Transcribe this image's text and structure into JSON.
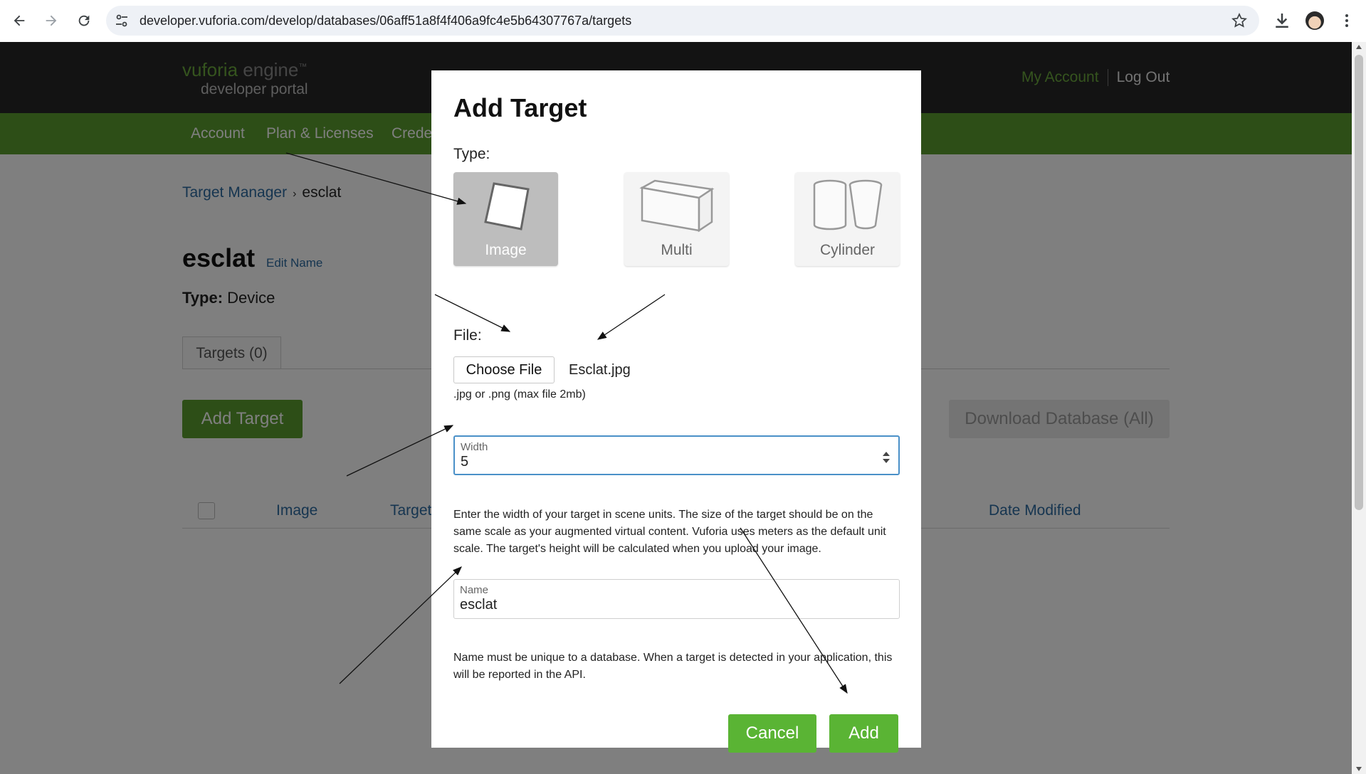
{
  "browser": {
    "url": "developer.vuforia.com/develop/databases/06aff51a8f4f406a9fc4e5b64307767a/targets"
  },
  "site": {
    "logo_brand": "vuforia",
    "logo_suffix": " engine",
    "logo_tm": "™",
    "logo_sub": "developer portal",
    "my_account": "My Account",
    "log_out": "Log Out",
    "nav": [
      "Account",
      "Plan & Licenses",
      "Crede"
    ]
  },
  "breadcrumb": {
    "root": "Target Manager",
    "separator": "›",
    "current": "esclat"
  },
  "database": {
    "name": "esclat",
    "edit_name": "Edit Name",
    "type_label": "Type:",
    "type_value": " Device",
    "tab": "Targets (0)",
    "add_target": "Add Target",
    "download": "Download Database (All)",
    "columns": [
      "Image",
      "Target",
      "Date Modified"
    ]
  },
  "modal": {
    "title": "Add Target",
    "type_label": "Type:",
    "types": [
      "Image",
      "Multi",
      "Cylinder"
    ],
    "selected_type": "Image",
    "file_label": "File:",
    "choose_file": "Choose File",
    "file_name": "Esclat.jpg",
    "file_hint": ".jpg or .png (max file 2mb)",
    "width_label": "Width",
    "width_value": "5",
    "width_help": "Enter the width of your target in scene units. The size of the target should be on the same scale as your augmented virtual content. Vuforia uses meters as the default unit scale. The target's height will be calculated when you upload your image.",
    "name_label": "Name",
    "name_value": "esclat",
    "name_help": "Name must be unique to a database. When a target is detected in your application, this will be reported in the API.",
    "cancel": "Cancel",
    "add": "Add"
  },
  "colors": {
    "brand_green": "#5a9d2f",
    "button_green": "#5ab434",
    "link_blue": "#2c6aa0",
    "header_dark": "#262626"
  }
}
